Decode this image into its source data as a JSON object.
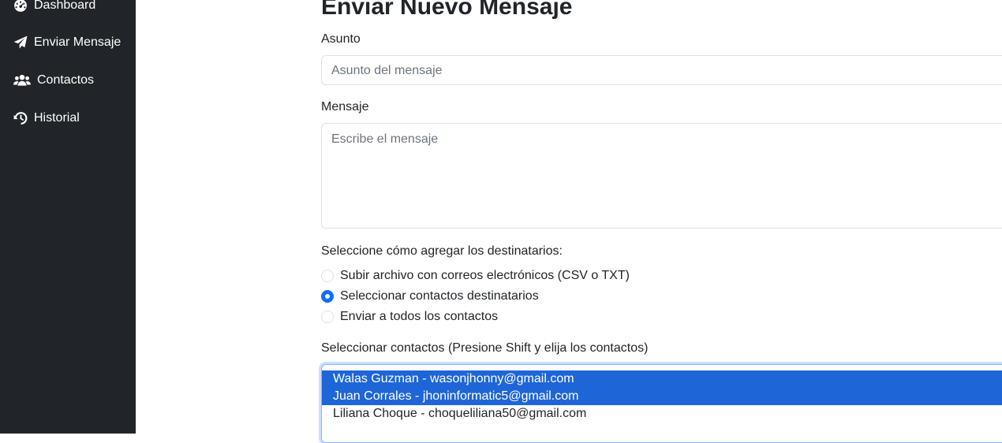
{
  "sidebar": {
    "items": [
      {
        "label": "Dashboard",
        "icon": "gauge-icon"
      },
      {
        "label": "Enviar Mensaje",
        "icon": "paper-plane-icon"
      },
      {
        "label": "Contactos",
        "icon": "users-icon"
      },
      {
        "label": "Historial",
        "icon": "history-icon"
      }
    ]
  },
  "form": {
    "title": "Enviar Nuevo Mensaje",
    "subject_label": "Asunto",
    "subject_placeholder": "Asunto del mensaje",
    "message_label": "Mensaje",
    "message_placeholder": "Escribe el mensaje",
    "recipients_prompt": "Seleccione cómo agregar los destinatarios:",
    "recipient_options": [
      {
        "label": "Subir archivo con correos electrónicos (CSV o TXT)",
        "checked": false
      },
      {
        "label": "Seleccionar contactos destinatarios",
        "checked": true
      },
      {
        "label": "Enviar a todos los contactos",
        "checked": false
      }
    ],
    "contacts_label": "Seleccionar contactos (Presione Shift y elija los contactos)",
    "contacts": [
      {
        "label": "Walas Guzman - wasonjhonny@gmail.com",
        "selected": true
      },
      {
        "label": "Juan Corrales - jhoninformatic5@gmail.com",
        "selected": true
      },
      {
        "label": "Liliana Choque - choqueliliana50@gmail.com",
        "selected": false
      }
    ]
  },
  "colors": {
    "sidebar_bg": "#212529",
    "accent": "#0d6efd",
    "selection": "#1e66d8"
  }
}
